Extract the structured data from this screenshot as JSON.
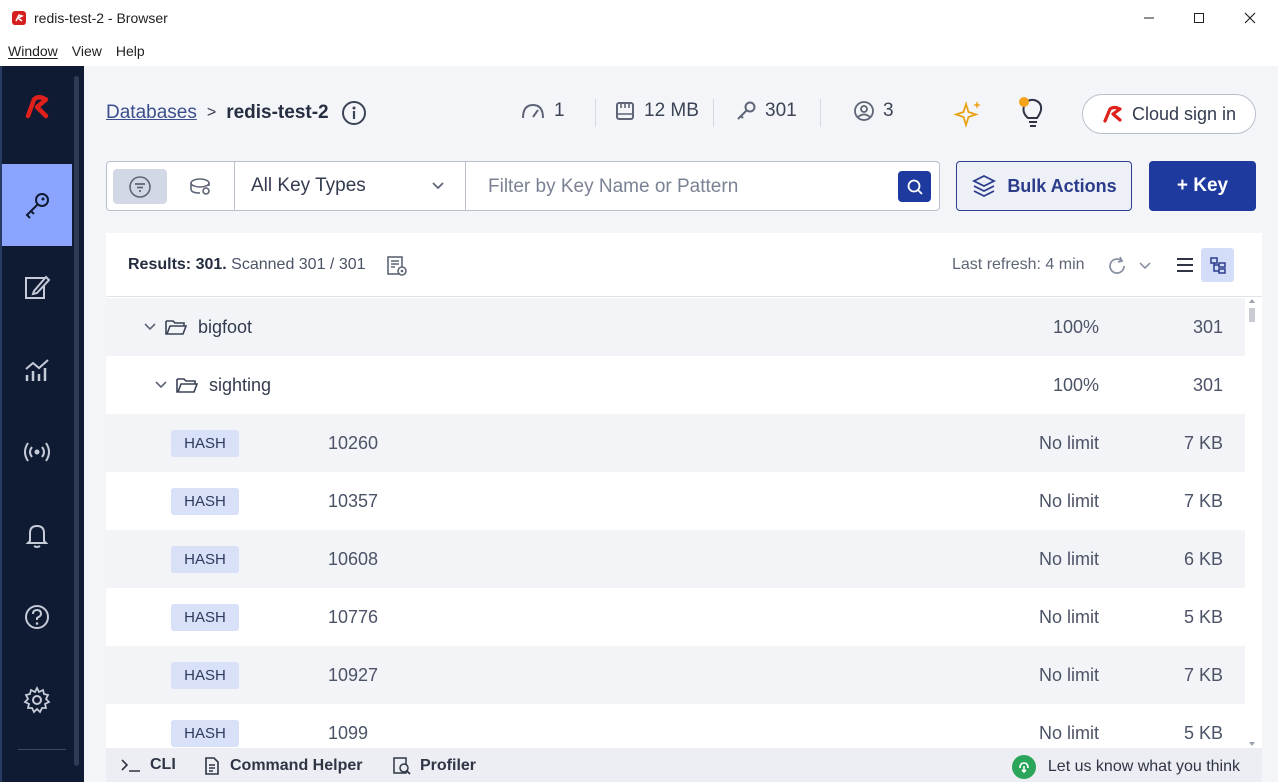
{
  "window": {
    "title": "redis-test-2 - Browser",
    "menu": [
      "Window",
      "View",
      "Help"
    ]
  },
  "header": {
    "breadcrumb_root": "Databases",
    "breadcrumb_sep": ">",
    "database_name": "redis-test-2",
    "stats": {
      "connections": "1",
      "memory": "12 MB",
      "keys": "301",
      "clients": "3"
    },
    "cloud_signin_label": "Cloud sign in"
  },
  "filter": {
    "key_type_selected": "All Key Types",
    "search_placeholder": "Filter by Key Name or Pattern",
    "bulk_actions_label": "Bulk Actions",
    "add_key_label": "+ Key"
  },
  "results": {
    "results_label": "Results: 301.",
    "scanned_label": "Scanned 301 / 301",
    "last_refresh_label": "Last refresh:",
    "last_refresh_value": "4 min"
  },
  "tree": {
    "folders": [
      {
        "name": "bigfoot",
        "percent": "100%",
        "count": "301"
      },
      {
        "name": "sighting",
        "percent": "100%",
        "count": "301"
      }
    ],
    "keys": [
      {
        "type": "HASH",
        "name": "10260",
        "ttl": "No limit",
        "size": "7 KB"
      },
      {
        "type": "HASH",
        "name": "10357",
        "ttl": "No limit",
        "size": "7 KB"
      },
      {
        "type": "HASH",
        "name": "10608",
        "ttl": "No limit",
        "size": "6 KB"
      },
      {
        "type": "HASH",
        "name": "10776",
        "ttl": "No limit",
        "size": "5 KB"
      },
      {
        "type": "HASH",
        "name": "10927",
        "ttl": "No limit",
        "size": "7 KB"
      },
      {
        "type": "HASH",
        "name": "1099",
        "ttl": "No limit",
        "size": "5 KB"
      }
    ]
  },
  "bottom": {
    "cli_label": "CLI",
    "command_helper_label": "Command Helper",
    "profiler_label": "Profiler",
    "feedback_label": "Let us know what you think"
  },
  "colors": {
    "nav_bg": "#0f1a33",
    "nav_active": "#8ba5ff",
    "primary": "#1e3a9e",
    "brand_red": "#e0201a"
  }
}
